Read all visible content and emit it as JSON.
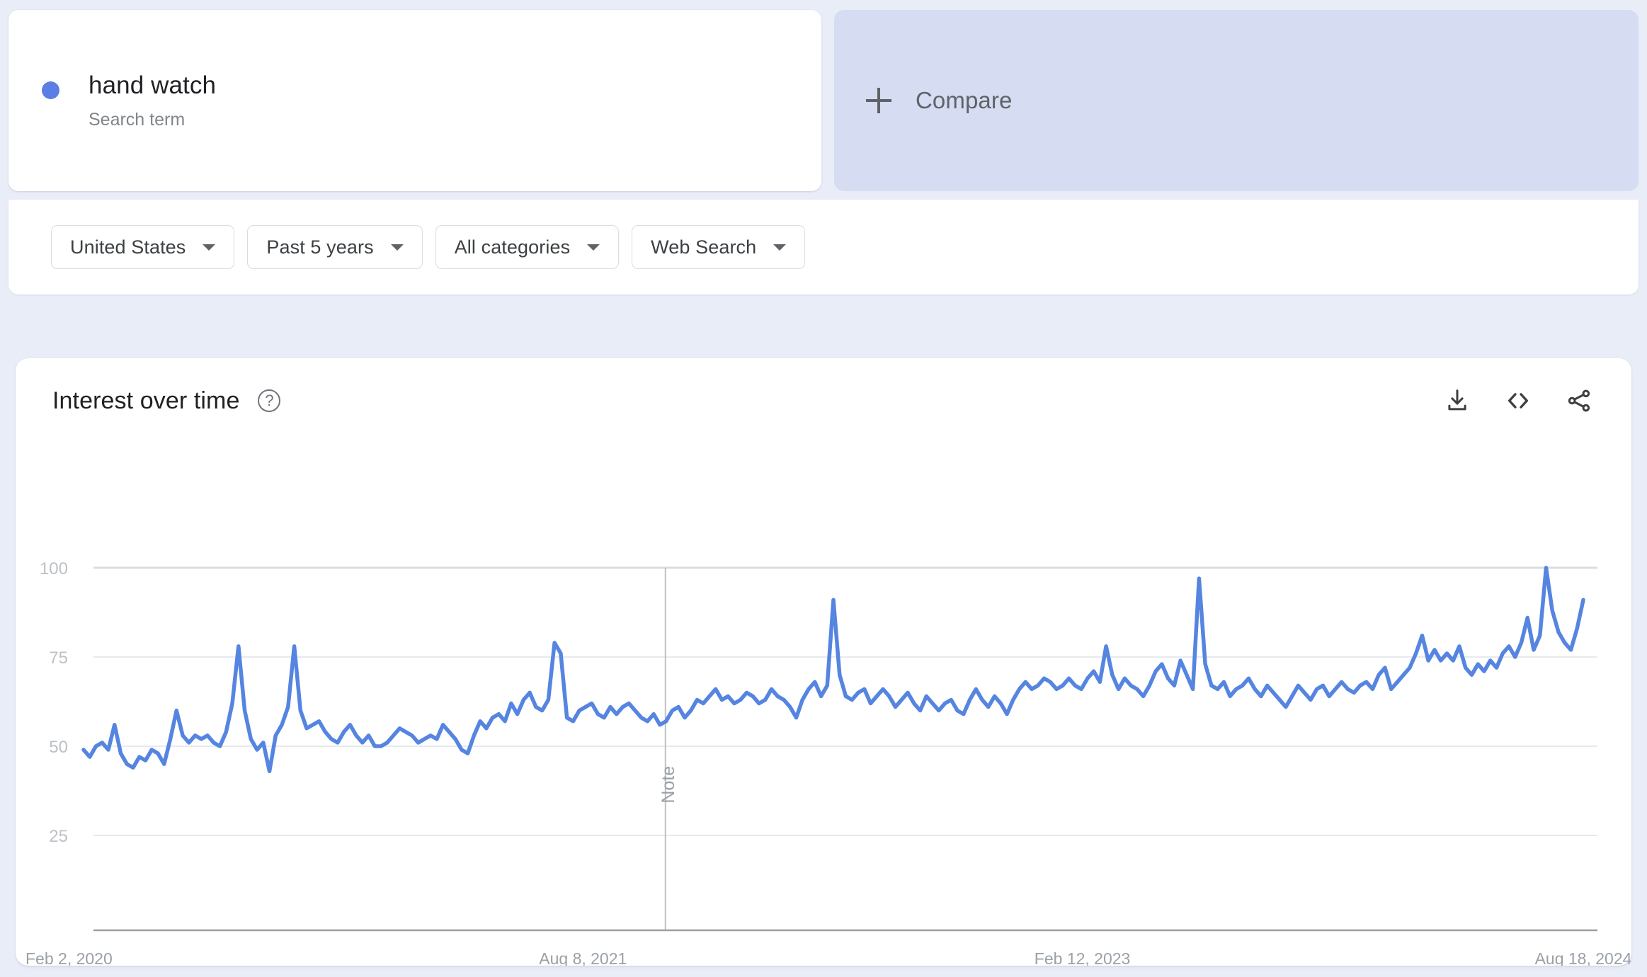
{
  "term": {
    "name": "hand watch",
    "type_label": "Search term",
    "dot_color": "#5b7fe4"
  },
  "compare": {
    "label": "Compare",
    "icon": "plus-icon",
    "background": "#d6ddf2"
  },
  "filters": [
    {
      "label": "United States",
      "name": "region"
    },
    {
      "label": "Past 5 years",
      "name": "time-range"
    },
    {
      "label": "All categories",
      "name": "category"
    },
    {
      "label": "Web Search",
      "name": "search-type"
    }
  ],
  "chart_panel": {
    "title": "Interest over time",
    "help_icon": "?",
    "actions": [
      {
        "name": "download-csv-icon",
        "label": "Download"
      },
      {
        "name": "embed-code-icon",
        "label": "Embed"
      },
      {
        "name": "share-icon",
        "label": "Share"
      }
    ]
  },
  "chart_data": {
    "type": "line",
    "title": "Interest over time",
    "xlabel": "",
    "ylabel": "",
    "ylim": [
      0,
      100
    ],
    "yticks": [
      25,
      50,
      75,
      100
    ],
    "xticks": [
      "Feb 2, 2020",
      "Aug 8, 2021",
      "Feb 12, 2023",
      "Aug 18, 2024"
    ],
    "xtick_positions": [
      0,
      0.333,
      0.666,
      1.0
    ],
    "grid": true,
    "legend": false,
    "line_color": "#5585e0",
    "annotations": [
      {
        "label": "Note",
        "x_fraction": 0.388,
        "orientation": "vertical"
      }
    ],
    "series": [
      {
        "name": "hand watch",
        "color": "#5585e0",
        "values": [
          49,
          47,
          50,
          51,
          49,
          56,
          48,
          45,
          44,
          47,
          46,
          49,
          48,
          45,
          52,
          60,
          53,
          51,
          53,
          52,
          53,
          51,
          50,
          54,
          62,
          78,
          60,
          52,
          49,
          51,
          43,
          53,
          56,
          61,
          78,
          60,
          55,
          56,
          57,
          54,
          52,
          51,
          54,
          56,
          53,
          51,
          53,
          50,
          50,
          51,
          53,
          55,
          54,
          53,
          51,
          52,
          53,
          52,
          56,
          54,
          52,
          49,
          48,
          53,
          57,
          55,
          58,
          59,
          57,
          62,
          59,
          63,
          65,
          61,
          60,
          63,
          79,
          76,
          58,
          57,
          60,
          61,
          62,
          59,
          58,
          61,
          59,
          61,
          62,
          60,
          58,
          57,
          59,
          56,
          57,
          60,
          61,
          58,
          60,
          63,
          62,
          64,
          66,
          63,
          64,
          62,
          63,
          65,
          64,
          62,
          63,
          66,
          64,
          63,
          61,
          58,
          63,
          66,
          68,
          64,
          67,
          91,
          70,
          64,
          63,
          65,
          66,
          62,
          64,
          66,
          64,
          61,
          63,
          65,
          62,
          60,
          64,
          62,
          60,
          62,
          63,
          60,
          59,
          63,
          66,
          63,
          61,
          64,
          62,
          59,
          63,
          66,
          68,
          66,
          67,
          69,
          68,
          66,
          67,
          69,
          67,
          66,
          69,
          71,
          68,
          78,
          70,
          66,
          69,
          67,
          66,
          64,
          67,
          71,
          73,
          69,
          67,
          74,
          70,
          66,
          97,
          73,
          67,
          66,
          68,
          64,
          66,
          67,
          69,
          66,
          64,
          67,
          65,
          63,
          61,
          64,
          67,
          65,
          63,
          66,
          67,
          64,
          66,
          68,
          66,
          65,
          67,
          68,
          66,
          70,
          72,
          66,
          68,
          70,
          72,
          76,
          81,
          74,
          77,
          74,
          76,
          74,
          78,
          72,
          70,
          73,
          71,
          74,
          72,
          76,
          78,
          75,
          79,
          86,
          77,
          81,
          100,
          88,
          82,
          79,
          77,
          83,
          91
        ]
      }
    ]
  }
}
